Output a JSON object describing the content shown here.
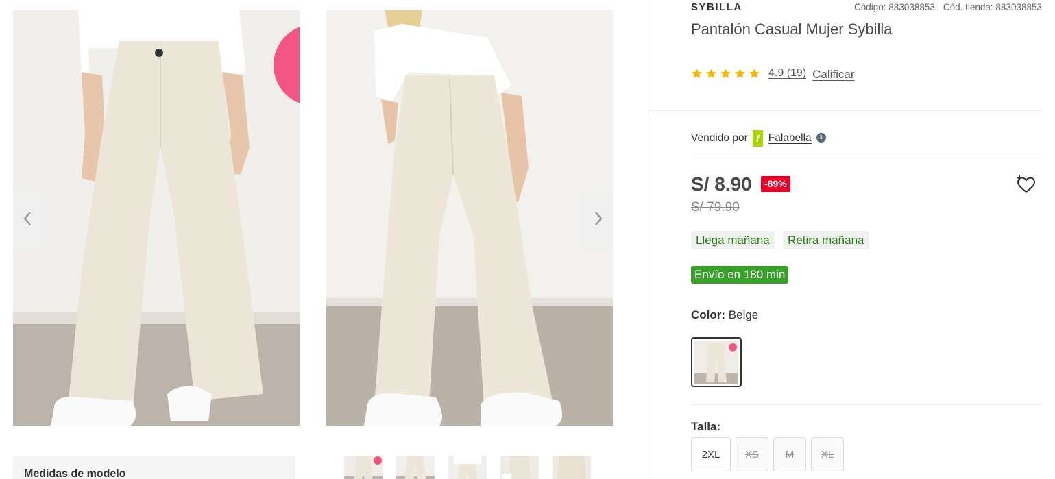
{
  "product": {
    "brand": "SYBILLA",
    "code": "Código: 883038853",
    "store_code": "Cód. tienda: 883038853",
    "title": "Pantalón Casual Mujer Sybilla",
    "rating": {
      "stars": 5,
      "value_text": "4.9 (19)"
    },
    "rate_label": "Calificar"
  },
  "seller": {
    "prefix": "Vendido por",
    "logo_glyph": "f",
    "name": "Falabella",
    "info_glyph": "i"
  },
  "pricing": {
    "price": "S/ 8.90",
    "discount": "-89%",
    "original": "S/ 79.90"
  },
  "shipping": {
    "tags": [
      "Llega mañana",
      "Retira mañana"
    ],
    "express": "Envío en 180 min"
  },
  "color": {
    "label": "Color:",
    "value": "Beige"
  },
  "sizes": {
    "label": "Talla:",
    "options": [
      "2XL",
      "XS",
      "M",
      "XL"
    ],
    "available": [
      true,
      false,
      false,
      false
    ]
  },
  "gallery": {
    "photos": [
      "front-view-photo",
      "back-view-photo"
    ],
    "thumbnail_count": 5,
    "model_measures_label": "Medidas de modelo"
  },
  "icons": {
    "prev": "chevron-left-icon",
    "next": "chevron-right-icon",
    "wishlist": "heart-plus-icon",
    "star": "star-icon"
  },
  "colors": {
    "discount_bg": "#eb0029",
    "express_bg": "#37a12a",
    "ship_tag_text": "#2d7a1a",
    "star": "#f5b800",
    "pants": "#ece7db",
    "floor": "#b9b0a6",
    "wall": "#f1efeb"
  }
}
